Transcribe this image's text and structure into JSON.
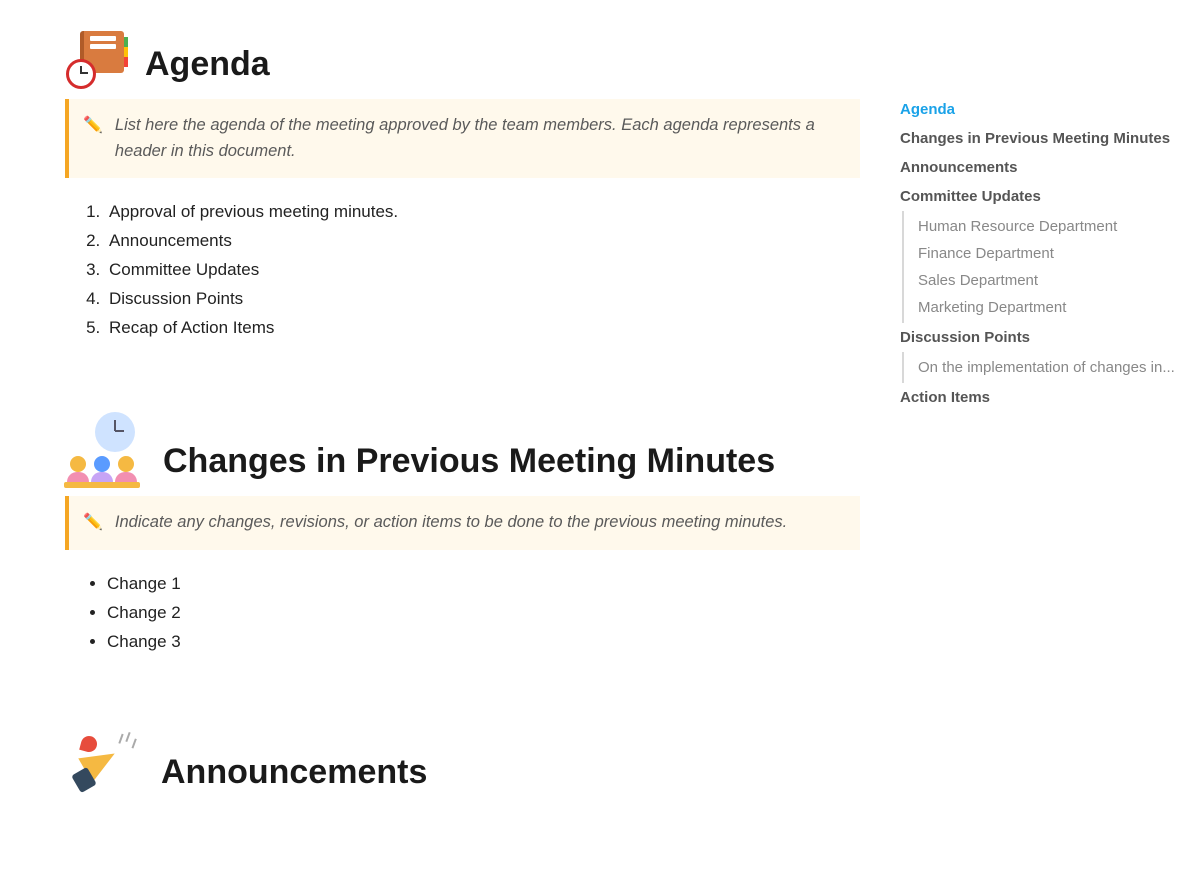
{
  "sections": {
    "agenda": {
      "title": "Agenda",
      "callout": "List here the agenda of the meeting approved by the team members. Each agenda represents a header in this document.",
      "items": [
        "Approval of previous meeting minutes.",
        "Announcements",
        "Committee Updates",
        "Discussion Points",
        "Recap of Action Items"
      ]
    },
    "changes": {
      "title": "Changes in Previous Meeting Minutes",
      "callout": "Indicate any changes, revisions, or action items to be done to the previous meeting minutes.",
      "items": [
        "Change 1",
        "Change 2",
        "Change 3"
      ]
    },
    "announcements": {
      "title": "Announcements"
    }
  },
  "outline": [
    {
      "label": "Agenda",
      "active": true
    },
    {
      "label": "Changes in Previous Meeting Minutes"
    },
    {
      "label": "Announcements"
    },
    {
      "label": "Committee Updates",
      "children": [
        {
          "label": "Human Resource Department"
        },
        {
          "label": "Finance Department"
        },
        {
          "label": "Sales Department"
        },
        {
          "label": "Marketing Department"
        }
      ]
    },
    {
      "label": "Discussion Points",
      "children": [
        {
          "label": "On the implementation of changes in..."
        }
      ]
    },
    {
      "label": "Action Items"
    }
  ]
}
